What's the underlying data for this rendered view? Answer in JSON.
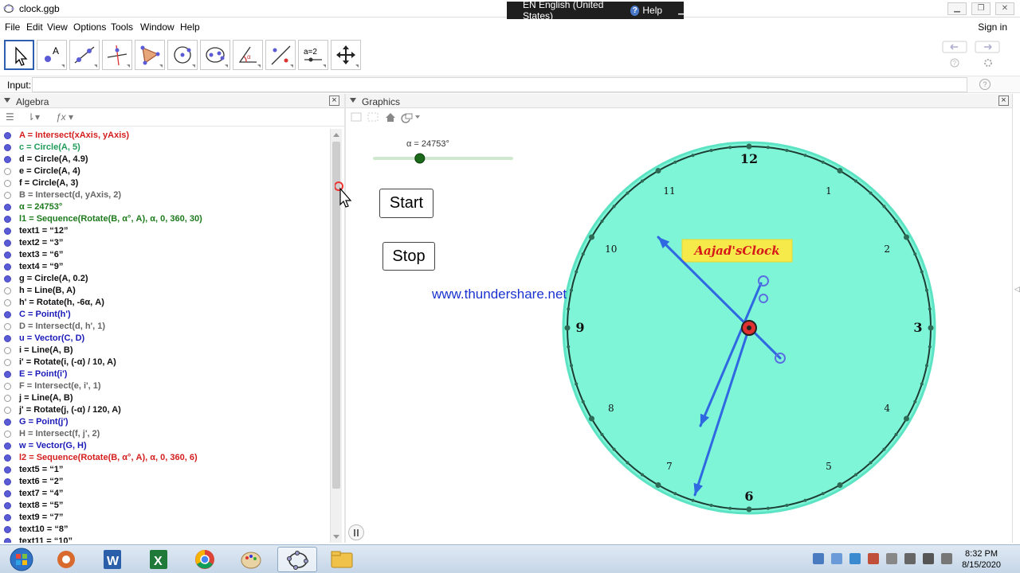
{
  "window": {
    "title": "clock.ggb"
  },
  "language_bar": {
    "language": "EN English (United States)",
    "help": "Help"
  },
  "menu": {
    "items": [
      "File",
      "Edit",
      "View",
      "Options",
      "Tools",
      "Window",
      "Help"
    ],
    "sign_in": "Sign in"
  },
  "toolbar": {
    "tools": [
      "move-tool",
      "point-tool",
      "line-tool",
      "perpendicular-line-tool",
      "polygon-tool",
      "circle-tool",
      "ellipse-tool",
      "angle-tool",
      "reflect-tool",
      "slider-tool",
      "move-graphics-tool"
    ],
    "slider_tool_label": "a=2"
  },
  "input_bar": {
    "label": "Input:",
    "value": ""
  },
  "algebra": {
    "title": "Algebra",
    "rows": [
      {
        "text": "A = Intersect(xAxis, yAxis)",
        "color": "#d41e1e",
        "visible": true
      },
      {
        "text": "c = Circle(A, 5)",
        "color": "#1f9c5a",
        "visible": true
      },
      {
        "text": "d = Circle(A, 4.9)",
        "color": "#111111",
        "visible": true
      },
      {
        "text": "e = Circle(A, 4)",
        "color": "#111111",
        "visible": false
      },
      {
        "text": "f = Circle(A, 3)",
        "color": "#111111",
        "visible": false
      },
      {
        "text": "B = Intersect(d, yAxis, 2)",
        "color": "#666666",
        "visible": false
      },
      {
        "text": "α = 24753°",
        "color": "#1d7a1d",
        "visible": true
      },
      {
        "text": "l1 = Sequence(Rotate(B, α°, A), α, 0, 360, 30)",
        "color": "#1d7a1d",
        "visible": true
      },
      {
        "text": "text1 = “12”",
        "color": "#111111",
        "visible": true
      },
      {
        "text": "text2 = “3”",
        "color": "#111111",
        "visible": true
      },
      {
        "text": "text3 = “6”",
        "color": "#111111",
        "visible": true
      },
      {
        "text": "text4 = “9”",
        "color": "#111111",
        "visible": true
      },
      {
        "text": "g = Circle(A, 0.2)",
        "color": "#111111",
        "visible": true
      },
      {
        "text": "h = Line(B, A)",
        "color": "#111111",
        "visible": false
      },
      {
        "text": "h' = Rotate(h, -6α, A)",
        "color": "#111111",
        "visible": false
      },
      {
        "text": "C = Point(h')",
        "color": "#1a1ab8",
        "visible": true
      },
      {
        "text": "D = Intersect(d, h', 1)",
        "color": "#666666",
        "visible": false
      },
      {
        "text": "u = Vector(C, D)",
        "color": "#1a1ab8",
        "visible": true
      },
      {
        "text": "i = Line(A, B)",
        "color": "#111111",
        "visible": false
      },
      {
        "text": "i' = Rotate(i, (-α) / 10, A)",
        "color": "#111111",
        "visible": false
      },
      {
        "text": "E = Point(i')",
        "color": "#1a1ab8",
        "visible": true
      },
      {
        "text": "F = Intersect(e, i', 1)",
        "color": "#666666",
        "visible": false
      },
      {
        "text": "j = Line(A, B)",
        "color": "#111111",
        "visible": false
      },
      {
        "text": "j' = Rotate(j, (-α) / 120, A)",
        "color": "#111111",
        "visible": false
      },
      {
        "text": "G = Point(j')",
        "color": "#1a1ab8",
        "visible": true
      },
      {
        "text": "H = Intersect(f, j', 2)",
        "color": "#666666",
        "visible": false
      },
      {
        "text": "w = Vector(G, H)",
        "color": "#1a1ab8",
        "visible": true
      },
      {
        "text": "l2 = Sequence(Rotate(B, α°, A), α, 0, 360, 6)",
        "color": "#d41e1e",
        "visible": true
      },
      {
        "text": "text5 = “1”",
        "color": "#111111",
        "visible": true
      },
      {
        "text": "text6 = “2”",
        "color": "#111111",
        "visible": true
      },
      {
        "text": "text7 = “4”",
        "color": "#111111",
        "visible": true
      },
      {
        "text": "text8 = “5”",
        "color": "#111111",
        "visible": true
      },
      {
        "text": "text9 = “7”",
        "color": "#111111",
        "visible": true
      },
      {
        "text": "text10 = “8”",
        "color": "#111111",
        "visible": true
      },
      {
        "text": "text11 = “10”",
        "color": "#111111",
        "visible": true
      }
    ]
  },
  "graphics": {
    "title": "Graphics",
    "slider": {
      "label": "α = 24753°",
      "fraction": 0.33
    },
    "start_button": "Start",
    "stop_button": "Stop",
    "website": "www.thundershare.net",
    "clock_title": "Aajad'sClock",
    "clock_face_color": "#7ff5d7",
    "hour_labels": [
      "12",
      "1",
      "2",
      "3",
      "4",
      "5",
      "6",
      "7",
      "8",
      "9",
      "10",
      "11"
    ],
    "bold_hour_labels": [
      "12",
      "3",
      "6",
      "9"
    ]
  },
  "taskbar": {
    "time": "8:32 PM",
    "date": "8/15/2020",
    "apps": [
      "start-orb",
      "media-app",
      "word-app",
      "excel-app",
      "chrome-app",
      "paint-app",
      "geogebra-app",
      "explorer-app"
    ]
  }
}
